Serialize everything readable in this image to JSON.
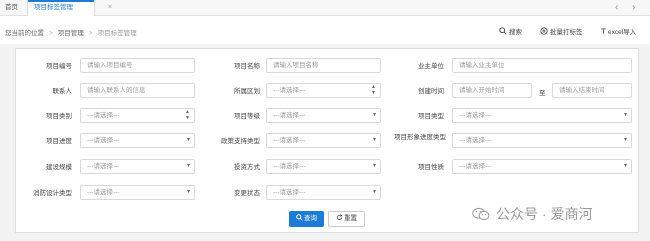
{
  "tabs": {
    "home": "首页",
    "active": "项目标签管理",
    "close": "×"
  },
  "nav": {
    "prev": "‹",
    "next": "›"
  },
  "breadcrumb": {
    "prefix": "您当前的位置",
    "level1": "项目管理",
    "current": "项目标签管理",
    "sep": ">"
  },
  "toolbar": {
    "search": "搜索",
    "batch": "批量打标签",
    "import": "excel导入"
  },
  "form": {
    "project_no": {
      "label": "项目编号",
      "placeholder": "请输入项目编号"
    },
    "project_name": {
      "label": "项目名称",
      "placeholder": "请输入项目名称"
    },
    "owner": {
      "label": "业主单位",
      "placeholder": "请输入业主单位"
    },
    "contact": {
      "label": "联系人",
      "placeholder": "请输入联系人的信息"
    },
    "region": {
      "label": "所属区划",
      "value": "---请选择---"
    },
    "created": {
      "label": "创建时间",
      "start_placeholder": "请输入开始时间",
      "to": "至",
      "end_placeholder": "请输入结束时间"
    },
    "category": {
      "label": "项目类别",
      "value": "---请选择---"
    },
    "level": {
      "label": "项目等级",
      "value": "---请选择---"
    },
    "type": {
      "label": "项目类型",
      "value": "---请选择---"
    },
    "progress": {
      "label": "项目进度",
      "value": "---请选择---"
    },
    "policy": {
      "label": "政策支持类型",
      "value": "---请选择---"
    },
    "image_progress": {
      "label": "项目形象进度类型",
      "value": "---请选择---"
    },
    "scale": {
      "label": "建设规模",
      "value": "---请选择---"
    },
    "invest": {
      "label": "投资方式",
      "value": "---请选择---"
    },
    "nature": {
      "label": "项目性质",
      "value": "---请选择---"
    },
    "fire": {
      "label": "消防设计类型",
      "value": "---请选择---"
    },
    "change": {
      "label": "变更状态",
      "value": "---请选择---"
    }
  },
  "actions": {
    "query": "查询",
    "reset": "重置"
  },
  "watermark": {
    "text": "公众号 · 爱商河"
  },
  "colors": {
    "accent": "#1e7bd6"
  }
}
